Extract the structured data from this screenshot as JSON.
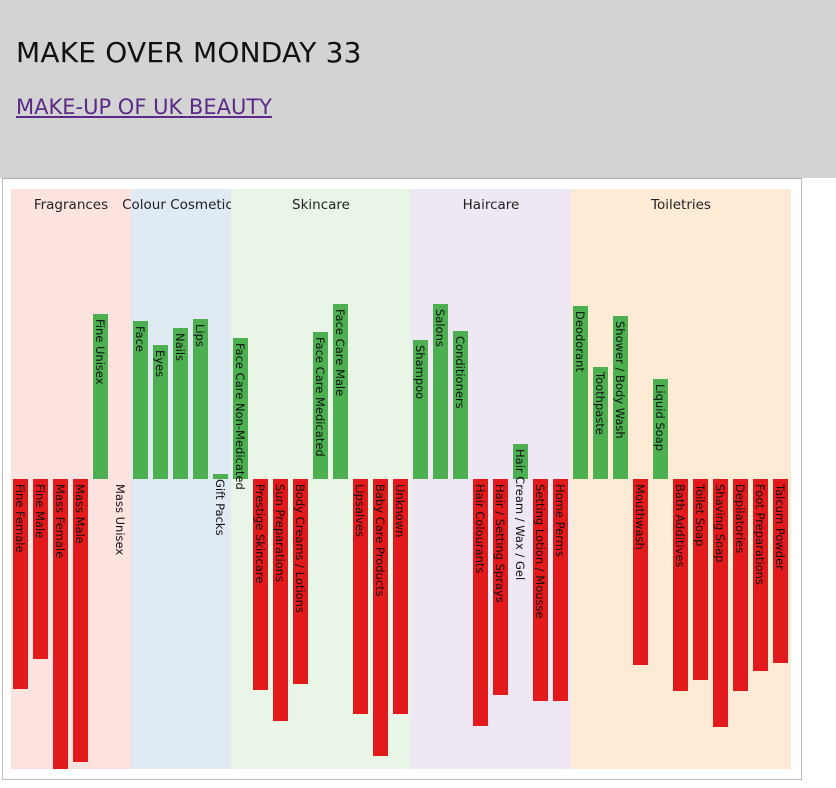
{
  "header": {
    "title": "MAKE OVER MONDAY 33",
    "link_text": "MAKE-UP OF UK BEAUTY"
  },
  "colors": {
    "positive": "#4caf50",
    "negative": "#e31a1c",
    "label_on_bar": "#111111",
    "bands": {
      "Fragrances": "#fde3df",
      "Colour Cosmetics": "#e0eaf3",
      "Skincare": "#e9f6e7",
      "Haircare": "#f0e7f5",
      "Toiletries": "#fdebd6"
    }
  },
  "chart_data": {
    "type": "bar",
    "title": "",
    "xlabel": "",
    "ylabel": "",
    "ylim": [
      -290,
      175
    ],
    "groups": [
      {
        "name": "Fragrances",
        "count": 6
      },
      {
        "name": "Colour Cosmetics",
        "count": 5
      },
      {
        "name": "Skincare",
        "count": 9
      },
      {
        "name": "Haircare",
        "count": 8
      },
      {
        "name": "Toiletries",
        "count": 11
      }
    ],
    "categories": [
      "Fine Female",
      "Fine Male",
      "Mass Female",
      "Mass Male",
      "Fine Unisex",
      "Mass Unisex",
      "Face",
      "Eyes",
      "Nails",
      "Lips",
      "Gift Packs",
      "Face Care Non-Medicated",
      "Prestige Skincare",
      "Sun Preparations",
      "Body Creams / Lotions",
      "Face Care Medicated",
      "Face Care Male",
      "Lipsalves",
      "Baby Care Products",
      "Unknown",
      "Shampoo",
      "Salons",
      "Conditioners",
      "Hair Colourants",
      "Hair / Setting Sprays",
      "Hair Cream / Wax / Gel",
      "Setting Lotion / Mousse",
      "Home Perms",
      "Deodorant",
      "Toothpaste",
      "Shower / Body Wash",
      "Mouthwash",
      "Liquid Soap",
      "Bath Additives",
      "Toilet Soap",
      "Shaving Soap",
      "Depilatories",
      "Foot Preparations",
      "Talcum Powder"
    ],
    "values": [
      -210,
      -180,
      -290,
      -283,
      165,
      0,
      158,
      134,
      151,
      160,
      5,
      141,
      -211,
      -242,
      -205,
      147,
      175,
      -235,
      -277,
      -235,
      139,
      175,
      148,
      -247,
      -216,
      35,
      -222,
      -222,
      173,
      112,
      163,
      -186,
      100,
      -212,
      -201,
      -248,
      -212,
      -192,
      -184
    ]
  }
}
